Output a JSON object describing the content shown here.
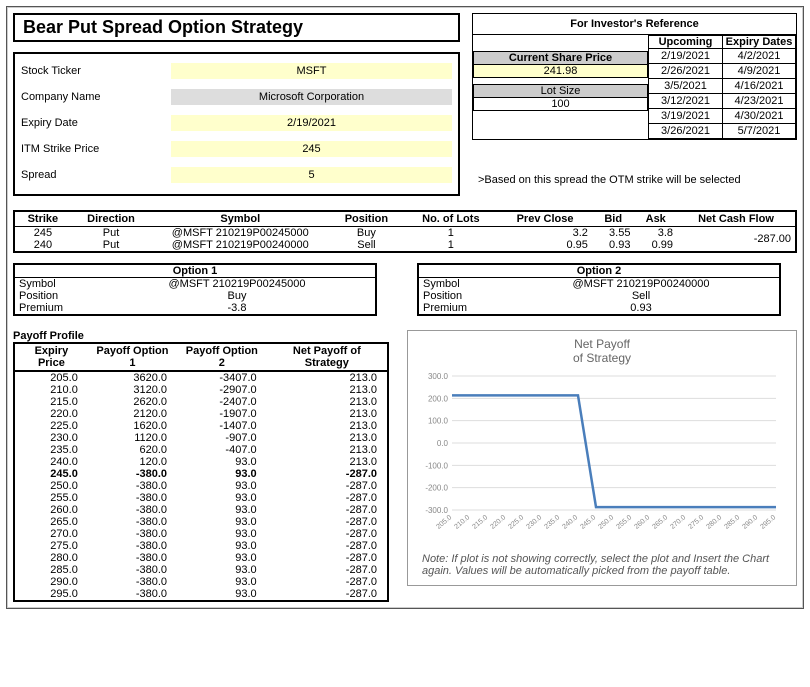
{
  "title": "Bear Put Spread Option Strategy",
  "inputs": {
    "ticker_label": "Stock Ticker",
    "ticker": "MSFT",
    "company_label": "Company Name",
    "company": "Microsoft Corporation",
    "expiry_label": "Expiry Date",
    "expiry": "2/19/2021",
    "strike_label": "ITM Strike Price",
    "strike": "245",
    "spread_label": "Spread",
    "spread": "5",
    "spread_note": ">Based on this spread the OTM strike will be selected"
  },
  "reference": {
    "title": "For Investor's Reference",
    "share_label": "Current Share Price",
    "share_price": "241.98",
    "lot_label": "Lot Size",
    "lot_size": "100",
    "upcoming_label": "Upcoming",
    "expiry_label": "Expiry Dates",
    "col1": [
      "2/19/2021",
      "2/26/2021",
      "3/5/2021",
      "3/12/2021",
      "3/19/2021",
      "3/26/2021"
    ],
    "col2": [
      "4/2/2021",
      "4/9/2021",
      "4/16/2021",
      "4/23/2021",
      "4/30/2021",
      "5/7/2021"
    ]
  },
  "orders": {
    "headers": [
      "Strike",
      "Direction",
      "Symbol",
      "Position",
      "No. of Lots",
      "Prev Close",
      "Bid",
      "Ask",
      "Net Cash Flow"
    ],
    "rows": [
      {
        "strike": "245",
        "dir": "Put",
        "sym": "@MSFT 210219P00245000",
        "pos": "Buy",
        "lots": "1",
        "prev": "3.2",
        "bid": "3.55",
        "ask": "3.8"
      },
      {
        "strike": "240",
        "dir": "Put",
        "sym": "@MSFT 210219P00240000",
        "pos": "Sell",
        "lots": "1",
        "prev": "0.95",
        "bid": "0.93",
        "ask": "0.99"
      }
    ],
    "net_cash_flow": "-287.00"
  },
  "option1": {
    "title": "Option 1",
    "symbol_label": "Symbol",
    "symbol": "@MSFT 210219P00245000",
    "position_label": "Position",
    "position": "Buy",
    "premium_label": "Premium",
    "premium": "-3.8"
  },
  "option2": {
    "title": "Option 2",
    "symbol_label": "Symbol",
    "symbol": "@MSFT 210219P00240000",
    "position_label": "Position",
    "position": "Sell",
    "premium_label": "Premium",
    "premium": "0.93"
  },
  "payoff": {
    "title": "Payoff Profile",
    "headers": [
      "Expiry Price",
      "Payoff Option 1",
      "Payoff Option 2",
      "Net Payoff of Strategy"
    ],
    "rows": [
      [
        "205.0",
        "3620.0",
        "-3407.0",
        "213.0"
      ],
      [
        "210.0",
        "3120.0",
        "-2907.0",
        "213.0"
      ],
      [
        "215.0",
        "2620.0",
        "-2407.0",
        "213.0"
      ],
      [
        "220.0",
        "2120.0",
        "-1907.0",
        "213.0"
      ],
      [
        "225.0",
        "1620.0",
        "-1407.0",
        "213.0"
      ],
      [
        "230.0",
        "1120.0",
        "-907.0",
        "213.0"
      ],
      [
        "235.0",
        "620.0",
        "-407.0",
        "213.0"
      ],
      [
        "240.0",
        "120.0",
        "93.0",
        "213.0"
      ],
      [
        "245.0",
        "-380.0",
        "93.0",
        "-287.0"
      ],
      [
        "250.0",
        "-380.0",
        "93.0",
        "-287.0"
      ],
      [
        "255.0",
        "-380.0",
        "93.0",
        "-287.0"
      ],
      [
        "260.0",
        "-380.0",
        "93.0",
        "-287.0"
      ],
      [
        "265.0",
        "-380.0",
        "93.0",
        "-287.0"
      ],
      [
        "270.0",
        "-380.0",
        "93.0",
        "-287.0"
      ],
      [
        "275.0",
        "-380.0",
        "93.0",
        "-287.0"
      ],
      [
        "280.0",
        "-380.0",
        "93.0",
        "-287.0"
      ],
      [
        "285.0",
        "-380.0",
        "93.0",
        "-287.0"
      ],
      [
        "290.0",
        "-380.0",
        "93.0",
        "-287.0"
      ],
      [
        "295.0",
        "-380.0",
        "93.0",
        "-287.0"
      ]
    ],
    "bold_index": 8
  },
  "chart_data": {
    "type": "line",
    "title": "Net Payoff",
    "subtitle": "of Strategy",
    "x": [
      205,
      210,
      215,
      220,
      225,
      230,
      235,
      240,
      245,
      250,
      255,
      260,
      265,
      270,
      275,
      280,
      285,
      290,
      295
    ],
    "y": [
      213,
      213,
      213,
      213,
      213,
      213,
      213,
      213,
      -287,
      -287,
      -287,
      -287,
      -287,
      -287,
      -287,
      -287,
      -287,
      -287,
      -287
    ],
    "ylim": [
      -300,
      300
    ],
    "yticks": [
      -300,
      -200,
      -100,
      0,
      100,
      200,
      300
    ],
    "xlabels": [
      "205.0",
      "210.0",
      "215.0",
      "220.0",
      "225.0",
      "230.0",
      "235.0",
      "240.0",
      "245.0",
      "250.0",
      "255.0",
      "260.0",
      "265.0",
      "270.0",
      "275.0",
      "280.0",
      "285.0",
      "290.0",
      "295.0"
    ],
    "note": "Note: If plot is not showing correctly, select the plot and Insert the Chart again. Values will be automatically picked from the payoff table."
  }
}
